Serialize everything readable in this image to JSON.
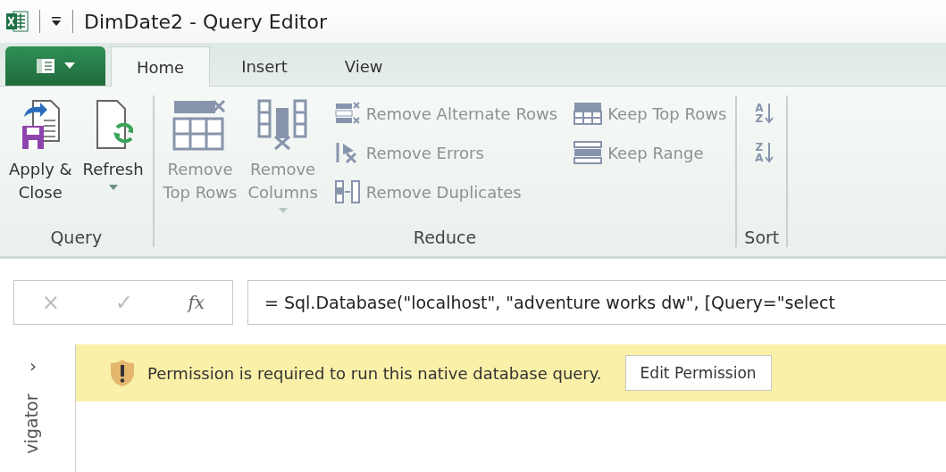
{
  "window": {
    "title": "DimDate2 - Query Editor"
  },
  "tabs": [
    {
      "label": "Home",
      "selected": true
    },
    {
      "label": "Insert",
      "selected": false
    },
    {
      "label": "View",
      "selected": false
    }
  ],
  "ribbon": {
    "groups": [
      {
        "label": "Query",
        "large_buttons": [
          {
            "kind": "apply",
            "label_lines": [
              "Apply &",
              "Close"
            ],
            "disabled": false,
            "dropdown": false
          },
          {
            "kind": "refresh",
            "label_lines": [
              "Refresh"
            ],
            "disabled": false,
            "dropdown": true
          }
        ]
      },
      {
        "label": "Reduce",
        "large_buttons": [
          {
            "kind": "remove-top-rows",
            "label_lines": [
              "Remove",
              "Top Rows"
            ],
            "disabled": true,
            "dropdown": false
          },
          {
            "kind": "remove-columns",
            "label_lines": [
              "Remove",
              "Columns"
            ],
            "disabled": true,
            "dropdown": true
          }
        ],
        "small_columns": [
          [
            {
              "kind": "alternate",
              "label": "Remove Alternate Rows",
              "disabled": true
            },
            {
              "kind": "errors",
              "label": "Remove Errors",
              "disabled": true
            },
            {
              "kind": "duplicates",
              "label": "Remove Duplicates",
              "disabled": true
            }
          ],
          [
            {
              "kind": "keep-top",
              "label": "Keep Top Rows",
              "disabled": true
            },
            {
              "kind": "keep-range",
              "label": "Keep Range",
              "disabled": true
            }
          ]
        ]
      },
      {
        "label": "Sort",
        "sort_buttons": [
          {
            "letters": [
              "A",
              "Z"
            ],
            "disabled": true
          },
          {
            "letters": [
              "Z",
              "A"
            ],
            "disabled": true
          }
        ]
      }
    ]
  },
  "formula_bar": {
    "cancel": "×",
    "confirm": "✓",
    "fx": "fx",
    "formula": "= Sql.Database(\"localhost\", \"adventure works dw\", [Query=\"select"
  },
  "navigator": {
    "toggle": "›",
    "label": "vigator"
  },
  "banner": {
    "message": "Permission is required to run this native database query.",
    "button": "Edit Permission"
  }
}
